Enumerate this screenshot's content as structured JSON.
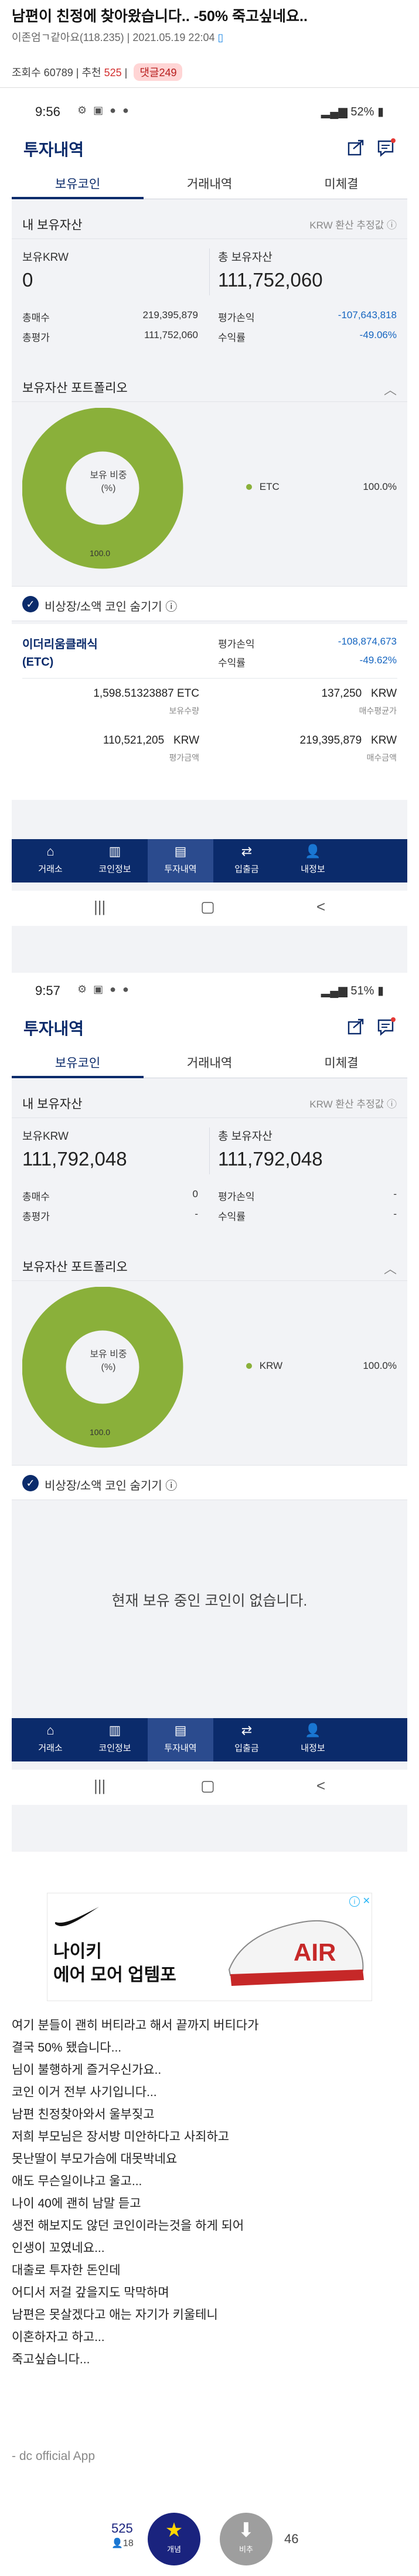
{
  "post": {
    "title": "남편이 친정에 찾아왔습니다.. -50% 죽고싶네요..",
    "author": "이존엄ㄱ같아요(118.235)",
    "date": "2021.05.19 22:04",
    "views_label": "조회수 60789",
    "recommend_label": "추천",
    "recommend_count": "525",
    "comment_label": "댓글249"
  },
  "screen1": {
    "time": "9:56",
    "battery": "52%",
    "app_title": "투자내역",
    "tabs": [
      "보유코인",
      "거래내역",
      "미체결"
    ],
    "my_assets_label": "내 보유자산",
    "krw_hint": "KRW 환산 추정값 ⓘ",
    "krw_label": "보유KRW",
    "krw_value": "0",
    "total_label": "총 보유자산",
    "total_value": "111,752,060",
    "buy_total_label": "총매수",
    "buy_total": "219,395,879",
    "eval_total_label": "총평가",
    "eval_total": "111,752,060",
    "pnl_label": "평가손익",
    "pnl": "-107,643,818",
    "rate_label": "수익률",
    "rate": "-49.06%",
    "portfolio_label": "보유자산 포트폴리오",
    "donut_center": "보유 비중\n(%)",
    "donut_bottom": "100.0",
    "legend_name": "ETC",
    "legend_value": "100.0%",
    "hide_label": "비상장/소액 코인 숨기기 ⓘ",
    "coin_name": "이더리움클래식\n(ETC)",
    "coin_pnl_label": "평가손익",
    "coin_pnl": "-108,874,673",
    "coin_rate_label": "수익률",
    "coin_rate": "-49.62%",
    "qty": "1,598.51323887",
    "qty_unit": "ETC",
    "qty_sub": "보유수량",
    "avg": "137,250",
    "avg_unit": "KRW",
    "avg_sub": "매수평균가",
    "eval": "110,521,205",
    "eval_unit": "KRW",
    "eval_sub": "평가금액",
    "buy": "219,395,879",
    "buy_unit": "KRW",
    "buy_sub": "매수금액"
  },
  "screen2": {
    "time": "9:57",
    "battery": "51%",
    "app_title": "투자내역",
    "tabs": [
      "보유코인",
      "거래내역",
      "미체결"
    ],
    "my_assets_label": "내 보유자산",
    "krw_hint": "KRW 환산 추정값 ⓘ",
    "krw_label": "보유KRW",
    "krw_value": "111,792,048",
    "total_label": "총 보유자산",
    "total_value": "111,792,048",
    "buy_total_label": "총매수",
    "buy_total": "0",
    "eval_total_label": "총평가",
    "eval_total": "-",
    "pnl_label": "평가손익",
    "pnl": "-",
    "rate_label": "수익률",
    "rate": "-",
    "portfolio_label": "보유자산 포트폴리오",
    "donut_center": "보유 비중\n(%)",
    "donut_bottom": "100.0",
    "legend_name": "KRW",
    "legend_value": "100.0%",
    "hide_label": "비상장/소액 코인 숨기기 ⓘ",
    "empty_text": "현재 보유 중인 코인이 없습니다."
  },
  "nav": [
    "거래소",
    "코인정보",
    "투자내역",
    "입출금",
    "내정보"
  ],
  "nav_icons": [
    "home-icon",
    "coin-info-icon",
    "invest-icon",
    "transfer-icon",
    "user-icon"
  ],
  "ad": {
    "brand": "NIKE",
    "title_line1": "나이키",
    "title_line2": "에어 모어 업템포"
  },
  "body_lines": [
    "여기 분들이 괜히 버티라고 해서 끝까지 버티다가",
    "결국 50% 됐습니다...",
    "님이 불행하게 즐거우신가요..",
    "코인 이거 전부 사기입니다...",
    "남편 친정찾아와서 울부짖고",
    "저희 부모님은 장서방 미안하다고 사죄하고",
    "못난딸이 부모가슴에 대못박네요",
    "애도 무슨일이냐고 울고...",
    "나이 40에 괜히 남말 듣고",
    "생전 해보지도 않던 코인이라는것을 하게 되어",
    "인생이 꼬였네요...",
    "대출로 투자한 돈인데",
    "어디서 저걸 갚을지도 막막하며",
    "남편은 못살겠다고 애는 자기가 키울테니",
    "이혼하자고 하고...",
    "죽고싶습니다..."
  ],
  "footer_app": "- dc official App",
  "votes": {
    "up_count": "525",
    "up_sub": "18",
    "up_label": "개념",
    "down_label": "비추",
    "down_count": "46"
  },
  "colors": {
    "navy": "#0b2b6b",
    "donut": "#8ab03a",
    "negative": "#1565c0",
    "comment_badge": "#ffd5d5"
  }
}
